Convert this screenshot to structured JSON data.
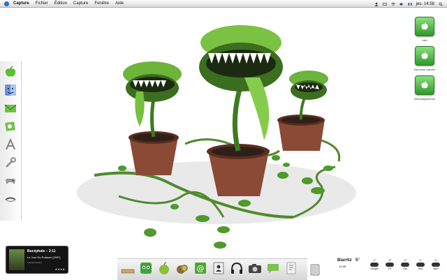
{
  "menubar": {
    "items": [
      "Capture",
      "Fichier",
      "Édition",
      "Capture",
      "Fenêtre",
      "Aide"
    ],
    "clock": "jeu. 14:58"
  },
  "volumes": [
    {
      "label": "mini",
      "icon": "apple-icon"
    },
    {
      "label": "Nouveau volume",
      "icon": "apple-icon"
    },
    {
      "label": "téléchargements",
      "icon": "apple-icon"
    }
  ],
  "itunes": {
    "title": "Bucéphale – 3:11",
    "album": "Le Jour Du Poisson (1997)",
    "artist": "Thomas Fersen",
    "rating": "★★★★"
  },
  "weather": {
    "city": "Biarritz",
    "time": "14:58",
    "current": "5°",
    "forecast": [
      {
        "day": "Tonight",
        "temp": "-1°"
      },
      {
        "day": "Fri",
        "temp": "-5°"
      },
      {
        "day": "Sat",
        "temp": "-1°"
      },
      {
        "day": "Sun",
        "temp": "-1°"
      },
      {
        "day": "Mon",
        "temp": "-1°"
      }
    ]
  },
  "colors": {
    "accent_green": "#3a9a2f",
    "menubar": "#e8e8e8"
  }
}
